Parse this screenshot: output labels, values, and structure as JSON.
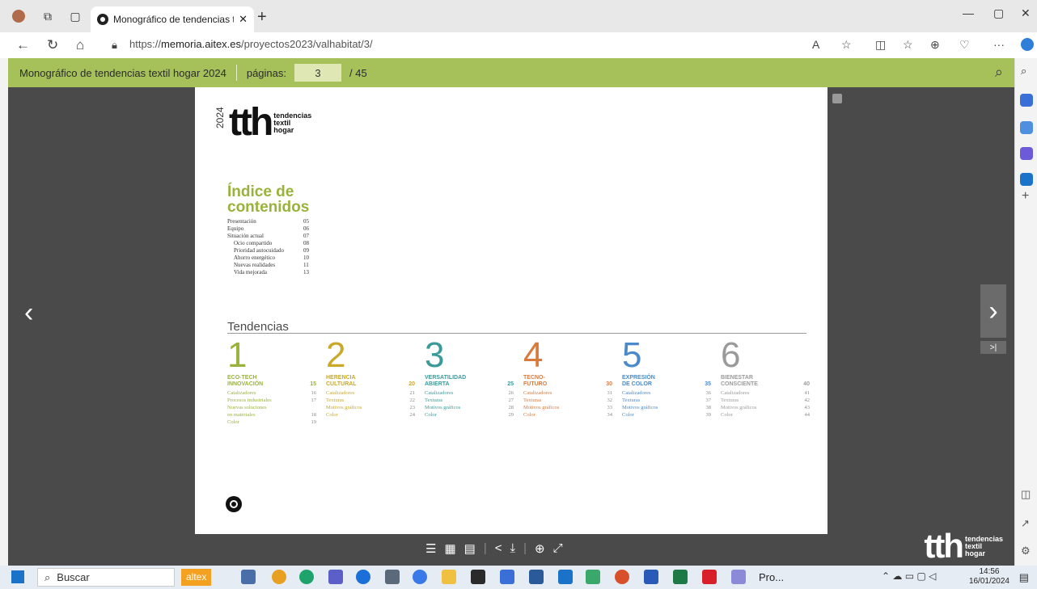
{
  "browser": {
    "tab_title": "Monográfico de tendencias texti",
    "url_prefix": "https://",
    "url_domain": "memoria.aitex.es",
    "url_path": "/proyectos2023/valhabitat/3/"
  },
  "viewer": {
    "doc_title": "Monográfico de tendencias textil hogar 2024",
    "pages_label": "páginas:",
    "current_page": "3",
    "total_pages": "/ 45"
  },
  "page": {
    "year": "2024",
    "logo_text": "tth",
    "logo_lines": [
      "tendencias",
      "textil",
      "hogar"
    ],
    "index_title_1": "Índice de",
    "index_title_2": "contenidos",
    "index": [
      {
        "label": "Presentación",
        "page": "05",
        "sub": false
      },
      {
        "label": "Equipo",
        "page": "06",
        "sub": false
      },
      {
        "label": "Situación actual",
        "page": "07",
        "sub": false
      },
      {
        "label": "Ocio compartido",
        "page": "08",
        "sub": true
      },
      {
        "label": "Prioridad autocuidado",
        "page": "09",
        "sub": true
      },
      {
        "label": "Ahorro energético",
        "page": "10",
        "sub": true
      },
      {
        "label": "Nuevas realidades",
        "page": "11",
        "sub": true
      },
      {
        "label": "Vida mejorada",
        "page": "13",
        "sub": true
      }
    ],
    "trends_title": "Tendencias",
    "trends": [
      {
        "num": "1",
        "name1": "ECO-TECH",
        "name2": "INNOVACIÓN",
        "page": "15",
        "color": "#98b23c",
        "items": [
          {
            "l": "Catalizadores",
            "p": "16"
          },
          {
            "l": "Procesos industriales",
            "p": "17"
          },
          {
            "l": "Nuevas soluciones",
            "p": ""
          },
          {
            "l": "en materiales",
            "p": "18"
          },
          {
            "l": "Color",
            "p": "19"
          }
        ]
      },
      {
        "num": "2",
        "name1": "HERENCIA",
        "name2": "CULTURAL",
        "page": "20",
        "color": "#c9a82a",
        "items": [
          {
            "l": "Catalizadores",
            "p": "21"
          },
          {
            "l": "Texturas",
            "p": "22"
          },
          {
            "l": "Motivos gráficos",
            "p": "23"
          },
          {
            "l": "Color",
            "p": "24"
          }
        ]
      },
      {
        "num": "3",
        "name1": "VERSATILIDAD",
        "name2": "ABIERTA",
        "page": "25",
        "color": "#3a9a9a",
        "items": [
          {
            "l": "Catalizadores",
            "p": "26"
          },
          {
            "l": "Texturas",
            "p": "27"
          },
          {
            "l": "Motivos gráficos",
            "p": "28"
          },
          {
            "l": "Color",
            "p": "29"
          }
        ]
      },
      {
        "num": "4",
        "name1": "TECNO-",
        "name2": "FUTURO",
        "page": "30",
        "color": "#d9793a",
        "items": [
          {
            "l": "Catalizadores",
            "p": "31"
          },
          {
            "l": "Texturas",
            "p": "32"
          },
          {
            "l": "Motivos gráficos",
            "p": "33"
          },
          {
            "l": "Color",
            "p": "34"
          }
        ]
      },
      {
        "num": "5",
        "name1": "EXPRESIÓN",
        "name2": "DE COLOR",
        "page": "35",
        "color": "#4a8ac9",
        "items": [
          {
            "l": "Catalizadores",
            "p": "36"
          },
          {
            "l": "Texturas",
            "p": "37"
          },
          {
            "l": "Motivos gráficos",
            "p": "38"
          },
          {
            "l": "Color",
            "p": "39"
          }
        ]
      },
      {
        "num": "6",
        "name1": "BIENESTAR",
        "name2": "CONSCIENTE",
        "page": "40",
        "color": "#9a9a9a",
        "items": [
          {
            "l": "Catalizadores",
            "p": "41"
          },
          {
            "l": "Texturas",
            "p": "42"
          },
          {
            "l": "Motivos gráficos",
            "p": "43"
          },
          {
            "l": "Color",
            "p": "44"
          }
        ]
      }
    ]
  },
  "taskbar": {
    "search_placeholder": "Buscar",
    "app_label": "altex",
    "pinned_label": "Pro...",
    "time": "14:56",
    "date": "16/01/2024"
  }
}
